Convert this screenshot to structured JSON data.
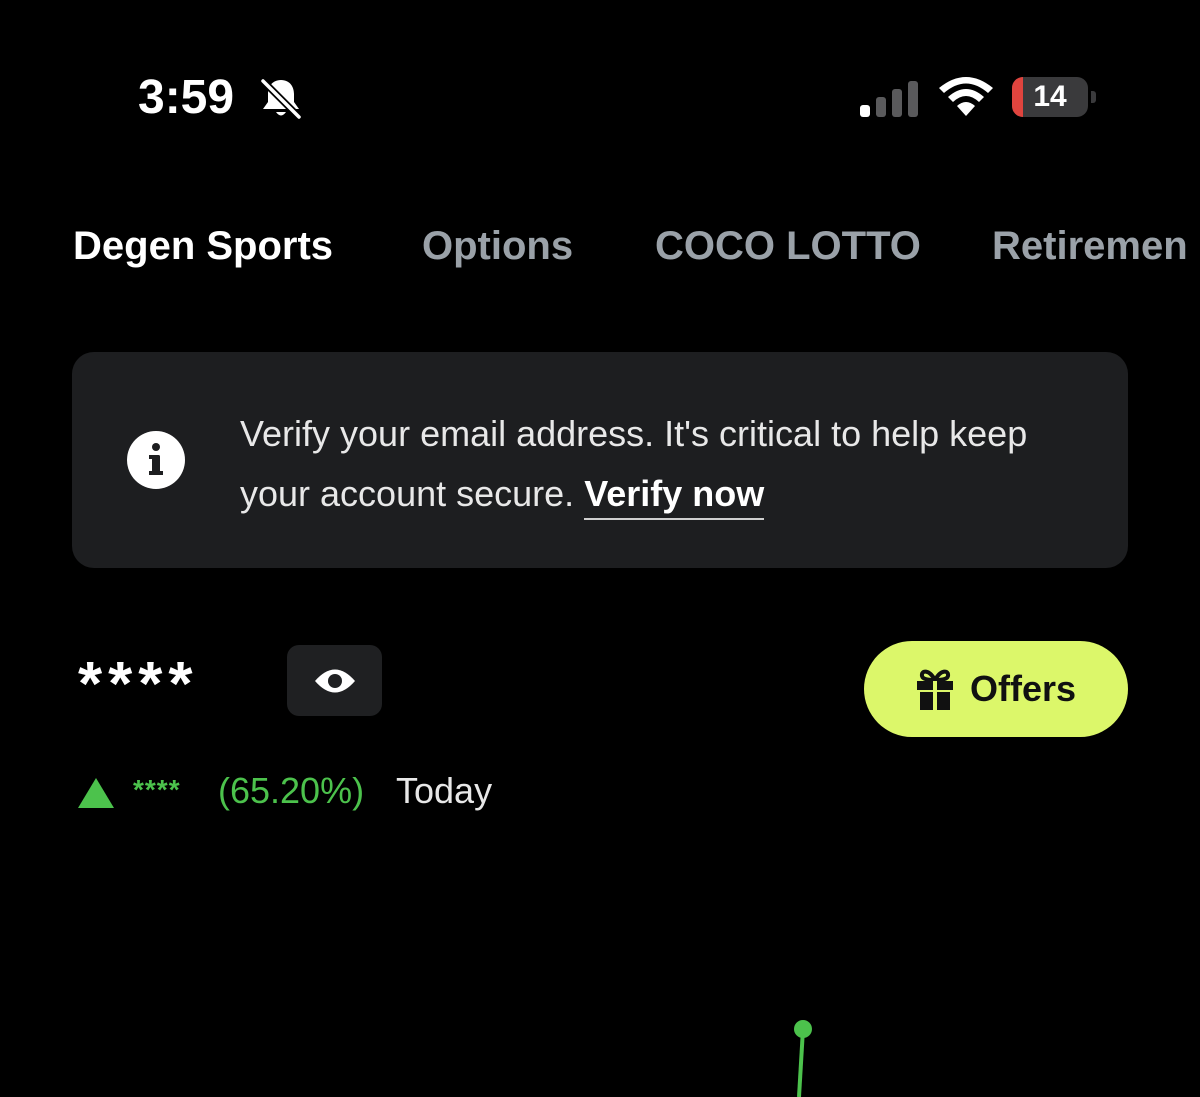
{
  "status_bar": {
    "time": "3:59",
    "battery_level": "14",
    "battery_fraction": 0.14,
    "signal_bars_active": 1,
    "signal_bars_total": 4
  },
  "tabs": [
    {
      "label": "Degen Sports",
      "active": true
    },
    {
      "label": "Options",
      "active": false
    },
    {
      "label": "COCO LOTTO",
      "active": false
    },
    {
      "label": "Retiremen",
      "active": false
    }
  ],
  "banner": {
    "text": "Verify your email address. It's critical to help keep your account secure.",
    "link_label": "Verify now"
  },
  "balance": {
    "masked_value": "****"
  },
  "offers": {
    "label": "Offers"
  },
  "change": {
    "amount_masked": "****",
    "percent": "(65.20%)",
    "period": "Today"
  },
  "colors": {
    "background": "#000000",
    "accent_green": "#4cc24c",
    "offers_button": "#dcf76a",
    "banner_bg": "#1d1e20",
    "battery_low": "#e0443e",
    "inactive_tab": "#9aa1a8"
  },
  "icons": {
    "bell": "bell-slash-icon",
    "signal": "cellular-signal-icon",
    "wifi": "wifi-icon",
    "info": "info-circle-icon",
    "eye": "eye-icon",
    "gift": "gift-icon",
    "trend": "triangle-up-icon"
  }
}
